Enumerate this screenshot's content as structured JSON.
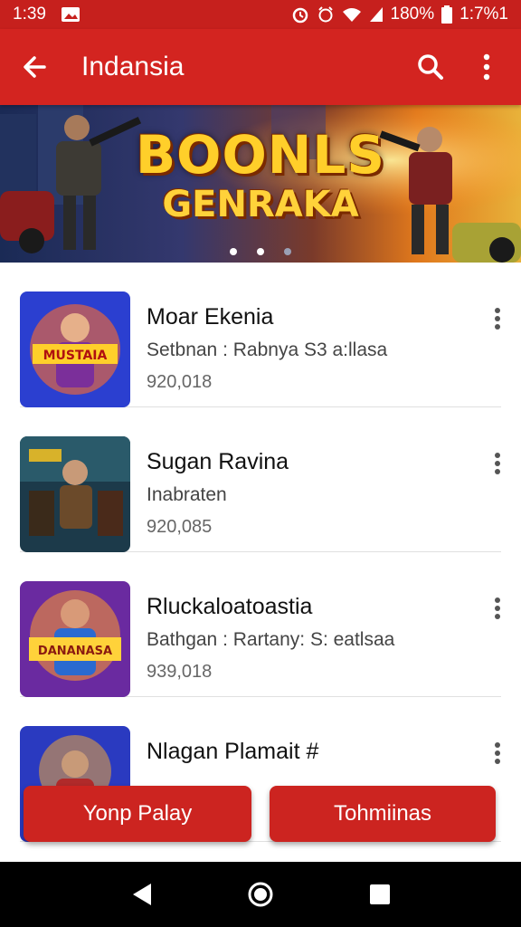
{
  "status_bar": {
    "time": "1:39",
    "battery": "180%",
    "right_time": "1:7%1"
  },
  "app_bar": {
    "title": "Indansia",
    "back_icon": "back-arrow-icon",
    "search_icon": "search-icon",
    "menu_icon": "more-vert-icon"
  },
  "banner": {
    "title_line1": "BOONLS",
    "title_line2": "GENRAKA",
    "dots": 3,
    "active_dot": 1
  },
  "items": [
    {
      "title": "Moar Ekenia",
      "subtitle": "Setbnan : Rabnya S3 a:llasa",
      "count": "920,018",
      "thumb_text": "MUSTAIA"
    },
    {
      "title": "Sugan Ravina",
      "subtitle": "Inabraten",
      "count": "920,085",
      "thumb_text": ""
    },
    {
      "title": "Rluckaloatoastia",
      "subtitle": "Bathgan : Rartany: S: eatlsaa",
      "count": "939,018",
      "thumb_text": "DANANASA"
    },
    {
      "title": "Nlagan Plamait #",
      "subtitle": "",
      "count": "",
      "thumb_text": ""
    }
  ],
  "buttons": {
    "left": "Yonp Palay",
    "right": "Tohmiinas"
  },
  "colors": {
    "primary": "#d32420",
    "status": "#c6201d",
    "button": "#cc2420"
  }
}
